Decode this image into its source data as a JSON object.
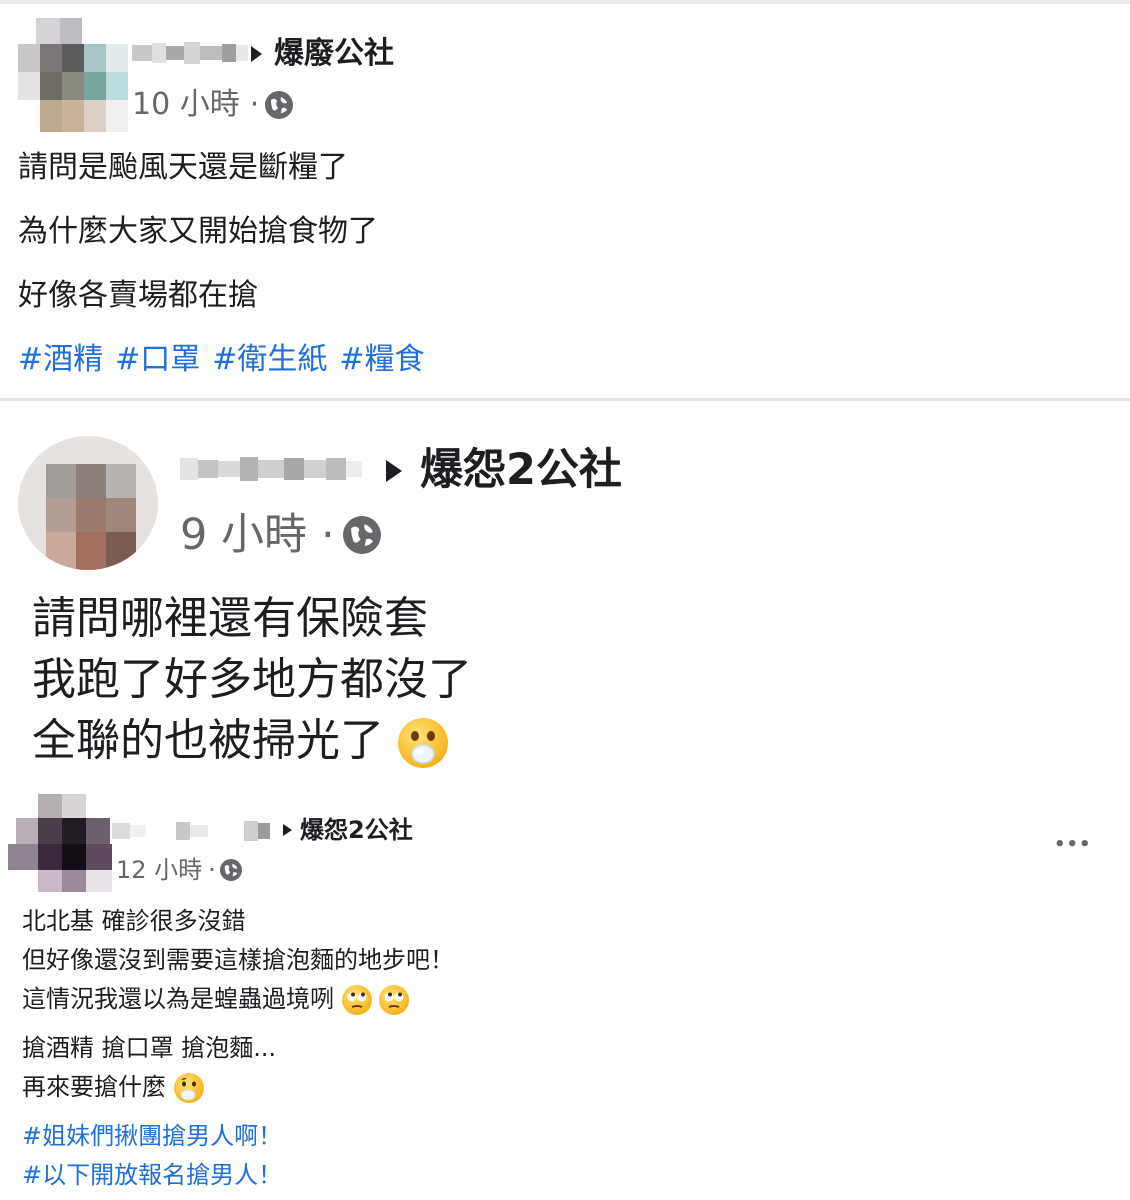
{
  "post1": {
    "group": "爆廢公社",
    "time": "10 小時",
    "sep": "·",
    "lines": [
      "請問是颱風天還是斷糧了",
      "為什麼大家又開始搶食物了",
      "好像各賣場都在搶"
    ],
    "tags": [
      "#酒精",
      "#口罩",
      "#衛生紙",
      "#糧食"
    ]
  },
  "post2": {
    "group": "爆怨2公社",
    "time": "9 小時",
    "sep": "·",
    "lines": [
      "請問哪裡還有保險套",
      "我跑了好多地方都沒了",
      "全聯的也被掃光了"
    ]
  },
  "post3": {
    "group": "爆怨2公社",
    "time": "12 小時",
    "sep": "·",
    "more": "•••",
    "lines1": [
      "北北基 確診很多沒錯",
      "但好像還沒到需要這樣搶泡麵的地步吧！",
      "這情況我還以為是蝗蟲過境咧"
    ],
    "lines2": [
      "搶酒精 搶口罩 搶泡麵...",
      "再來要搶什麼"
    ],
    "tags": [
      "#姐妹們揪團搶男人啊！",
      "#以下開放報名搶男人！"
    ]
  },
  "icons": {
    "globe": "globe-icon",
    "arrow": "triangle-right-icon",
    "more": "more-options-icon",
    "emoji_gasp": "face-exhaling-icon",
    "emoji_eyeroll": "face-rolling-eyes-icon",
    "emoji_think": "thinking-face-icon"
  },
  "colors": {
    "link": "#216fdb",
    "meta": "#65676b",
    "text": "#1c1e21",
    "divider": "#e4e6eb"
  }
}
